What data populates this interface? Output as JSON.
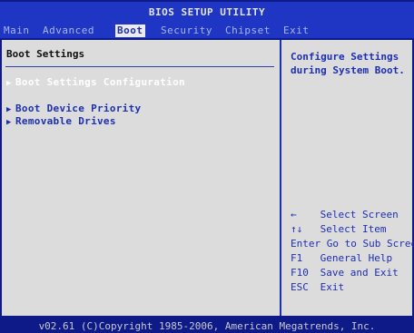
{
  "title": "BIOS SETUP UTILITY",
  "menu": [
    "Main",
    "Advanced",
    "Boot",
    "Security",
    "Chipset",
    "Exit"
  ],
  "active_menu": "Boot",
  "section_title": "Boot Settings",
  "items": [
    {
      "label": "Boot Settings Configuration",
      "disabled": true
    },
    {
      "label": "Boot Device Priority",
      "disabled": false
    },
    {
      "label": "Removable Drives",
      "disabled": false
    }
  ],
  "help": {
    "text": "Configure Settings during System Boot."
  },
  "keys": [
    {
      "key": "←",
      "desc": "Select Screen"
    },
    {
      "key": "↑↓",
      "desc": "Select Item"
    },
    {
      "key": "Enter",
      "desc": "Go to Sub Screen"
    },
    {
      "key": "F1",
      "desc": "General Help"
    },
    {
      "key": "F10",
      "desc": "Save and Exit"
    },
    {
      "key": "ESC",
      "desc": "Exit"
    }
  ],
  "footer": "v02.61 (C)Copyright 1985-2006, American Megatrends, Inc.",
  "colors": {
    "background": "#0e1a88",
    "panel": "#dcdcdc",
    "accent": "#1d2fb0"
  }
}
